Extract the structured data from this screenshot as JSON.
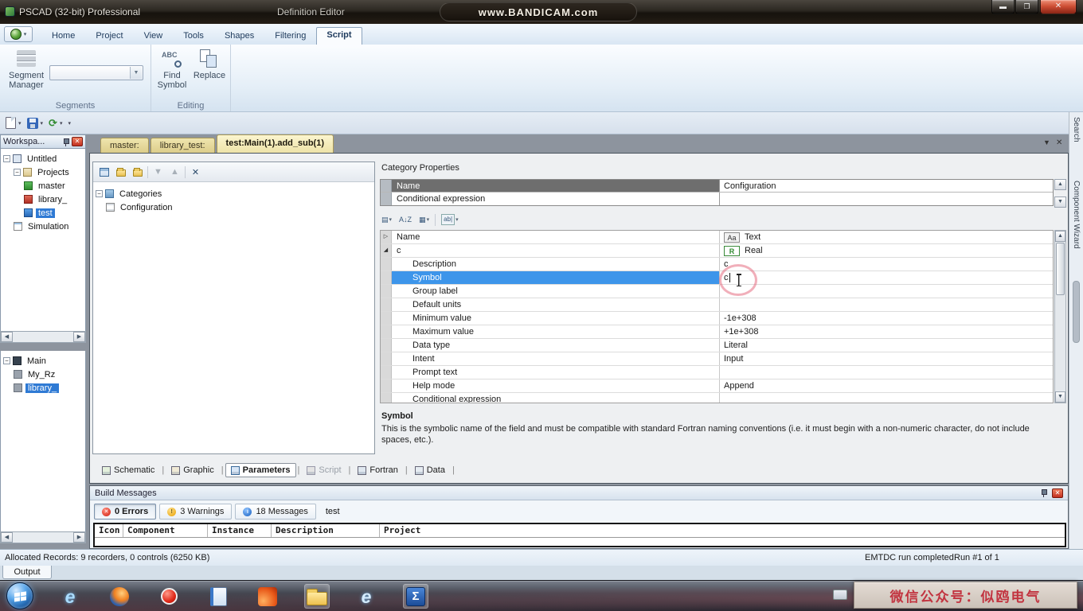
{
  "window": {
    "app_title": "PSCAD (32-bit) Professional",
    "doc_title": "Definition Editor"
  },
  "watermark": {
    "text": "www.BANDICAM.com"
  },
  "ribbon": {
    "tabs": [
      "Home",
      "Project",
      "View",
      "Tools",
      "Shapes",
      "Filtering",
      "Script"
    ],
    "active_tab": "Script",
    "segments": {
      "group_label": "Segments",
      "segment_manager": "Segment Manager"
    },
    "editing": {
      "group_label": "Editing",
      "find_symbol": "Find Symbol",
      "replace": "Replace"
    }
  },
  "workspace": {
    "title": "Workspa...",
    "tree": [
      {
        "label": "Untitled",
        "depth": 0,
        "icon": "workspace",
        "expander": true
      },
      {
        "label": "Projects",
        "depth": 1,
        "icon": "projects",
        "expander": true
      },
      {
        "label": "master",
        "depth": 2,
        "icon": "project-green"
      },
      {
        "label": "library_",
        "depth": 2,
        "icon": "project-red"
      },
      {
        "label": "test",
        "depth": 2,
        "icon": "project-blue",
        "selected": true
      },
      {
        "label": "Simulation",
        "depth": 1,
        "icon": "simulation"
      }
    ]
  },
  "component_tree": [
    {
      "label": "Main",
      "depth": 0,
      "icon": "module-dark",
      "expander": true
    },
    {
      "label": "My_Rz",
      "depth": 1,
      "icon": "module-gray"
    },
    {
      "label": "library_",
      "depth": 1,
      "icon": "module-gray",
      "selected": true
    }
  ],
  "document_tabs": [
    {
      "label": "master:"
    },
    {
      "label": "library_test:"
    },
    {
      "label": "test:Main(1).add_sub(1)",
      "active": true
    }
  ],
  "categories_panel": {
    "tree": [
      {
        "label": "Categories",
        "depth": 0,
        "icon": "categories-folder",
        "expander": true
      },
      {
        "label": "Configuration",
        "depth": 1,
        "icon": "category-page"
      }
    ]
  },
  "category_properties": {
    "title": "Category Properties",
    "header_rows": [
      {
        "label": "Name",
        "value": "Configuration",
        "header_style": true
      },
      {
        "label": "Conditional expression",
        "value": ""
      }
    ],
    "grid_rows": [
      {
        "label": "Name",
        "value": "Text",
        "badge": "Aa",
        "gutter": "collapsed",
        "level": 0
      },
      {
        "label": "c",
        "value": "Real",
        "badge": "R",
        "gutter": "expanded",
        "level": 0
      },
      {
        "label": "Description",
        "value": "c",
        "level": 1
      },
      {
        "label": "Symbol",
        "value": "c",
        "level": 1,
        "selected": true,
        "caret": true
      },
      {
        "label": "Group label",
        "value": "",
        "level": 1
      },
      {
        "label": "Default units",
        "value": "",
        "level": 1
      },
      {
        "label": "Minimum value",
        "value": "-1e+308",
        "level": 1
      },
      {
        "label": "Maximum value",
        "value": "+1e+308",
        "level": 1
      },
      {
        "label": "Data type",
        "value": "Literal",
        "level": 1
      },
      {
        "label": "Intent",
        "value": "Input",
        "level": 1
      },
      {
        "label": "Prompt text",
        "value": "",
        "level": 1
      },
      {
        "label": "Help mode",
        "value": "Append",
        "level": 1
      },
      {
        "label": "Conditional expression",
        "value": "",
        "level": 1
      }
    ],
    "help_title": "Symbol",
    "help_text": "This is the symbolic name of the field and must be compatible with standard Fortran naming conventions (i.e. it must begin with a non-numeric character, do not include spaces, etc.)."
  },
  "view_tabs": [
    {
      "label": "Schematic",
      "icon": "schematic"
    },
    {
      "label": "Graphic",
      "icon": "graphic"
    },
    {
      "label": "Parameters",
      "icon": "parameters",
      "active": true
    },
    {
      "label": "Script",
      "icon": "script",
      "disabled": true
    },
    {
      "label": "Fortran",
      "icon": "fortran"
    },
    {
      "label": "Data",
      "icon": "data"
    }
  ],
  "build_messages": {
    "title": "Build Messages",
    "filters": [
      {
        "label": "0 Errors",
        "icon": "error",
        "pressed": true
      },
      {
        "label": "3 Warnings",
        "icon": "warning"
      },
      {
        "label": "18 Messages",
        "icon": "message"
      }
    ],
    "scope": "test",
    "columns": [
      "Icon",
      "Component",
      "Instance",
      "Description",
      "Project"
    ]
  },
  "status_bar": {
    "left": "Allocated Records: 9 recorders, 0 controls (6250 KB)",
    "run_status": "EMTDC run completed.",
    "run_count": "Run #1 of 1"
  },
  "output_tab": "Output",
  "side_tabs": [
    "Search",
    "Component Wizard"
  ],
  "taskbar": {
    "icons": [
      {
        "name": "start-orb"
      },
      {
        "name": "internet-explorer"
      },
      {
        "name": "firefox"
      },
      {
        "name": "bandicam-record"
      },
      {
        "name": "notebook"
      },
      {
        "name": "matlab"
      },
      {
        "name": "folder",
        "active": true
      },
      {
        "name": "internet-explorer-2"
      },
      {
        "name": "pscad-sigma",
        "active": true
      }
    ],
    "tray_overlay_text": "微信公众号：似鸥电气"
  }
}
